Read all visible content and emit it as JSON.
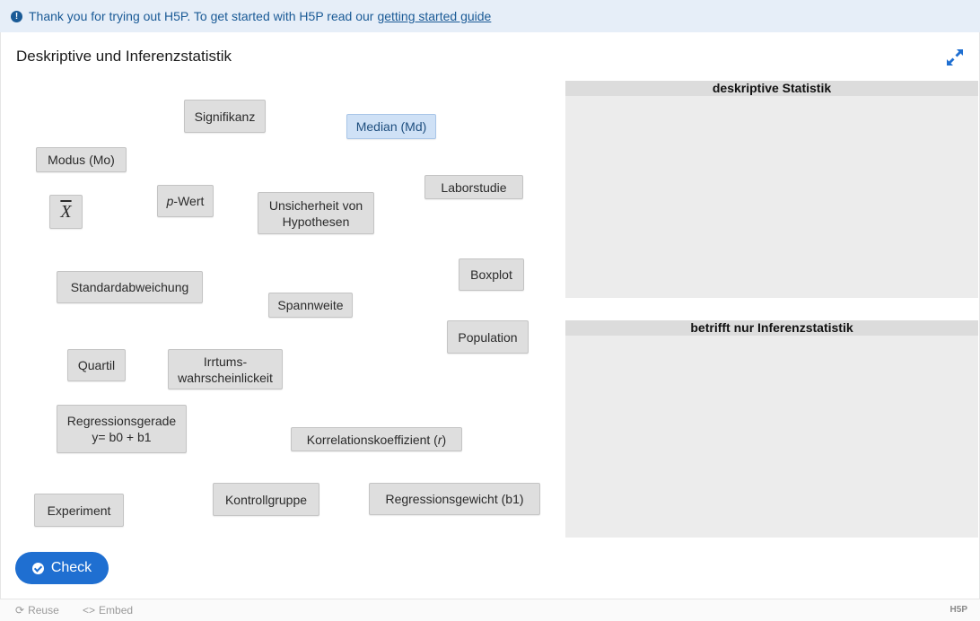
{
  "notice": {
    "text": "Thank you for trying out H5P. To get started with H5P read our",
    "link": "getting started guide"
  },
  "title": "Deskriptive und Inferenzstatistik",
  "draggables": {
    "signifikanz": "Signifikanz",
    "median": "Median (Md)",
    "modus": "Modus (Mo)",
    "xbar": "X",
    "pwert_var": "p",
    "pwert_rest": "-Wert",
    "unsicherheit_1": "Unsicherheit von",
    "unsicherheit_2": "Hypothesen",
    "laborstudie": "Laborstudie",
    "boxplot": "Boxplot",
    "standardabweichung": "Standardabweichung",
    "spannweite": "Spannweite",
    "population": "Population",
    "quartil": "Quartil",
    "irrtum_1": "Irrtums-",
    "irrtum_2": "wahrscheinlickeit",
    "regression_1": "Regressionsgerade",
    "regression_2": "y= b0 + b1",
    "korrelation_text": "Korrelationskoeffizient (",
    "korrelation_var": "r",
    "korrelation_end": ")",
    "experiment": "Experiment",
    "kontrollgruppe": "Kontrollgruppe",
    "regressionsgewicht": "Regressionsgewicht (b1)"
  },
  "zones": {
    "deskriptiv": "deskriptive Statistik",
    "inferenz": "betrifft nur Inferenzstatistik"
  },
  "buttons": {
    "check": "Check"
  },
  "footer": {
    "reuse": "Reuse",
    "embed": "Embed",
    "logo": "H5P"
  },
  "colors": {
    "accent": "#1f6fd1",
    "notice_bg": "#e6eef8",
    "chip_bg": "#dedede",
    "chip_selected_bg": "#cfe1f6",
    "zone_bg": "#ececec"
  }
}
